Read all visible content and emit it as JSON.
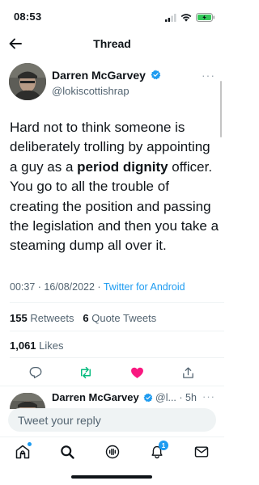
{
  "status_bar": {
    "time": "08:53"
  },
  "header": {
    "title": "Thread",
    "back_icon": "arrow-left-icon"
  },
  "tweet": {
    "author_name": "Darren McGarvey",
    "handle": "@lokiscottishrap",
    "more": "···",
    "text_part1": "Hard not to think someone is deliberately trolling by appointing a guy as a ",
    "text_bold": "period dignity",
    "text_part2": " officer. You go to all the trouble of creating the position and passing the legislation and then you take a steaming dump all over it.",
    "timestamp": "00:37 · 16/08/2022 · ",
    "source": "Twitter for Android",
    "retweets_count": "155",
    "retweets_label": "Retweets",
    "quote_count": "6",
    "quote_label": "Quote Tweets",
    "likes_count": "1,061",
    "likes_label": "Likes",
    "liked": true,
    "accent_color": "#1d9bf0",
    "like_color": "#f91880",
    "retweet_color": "#00ba7c"
  },
  "reply_preview": {
    "author_name": "Darren McGarvey",
    "handle": "@l... · 5h",
    "more": "···"
  },
  "compose": {
    "placeholder": "Tweet your reply"
  },
  "tabbar": {
    "items": [
      {
        "icon": "home-icon",
        "has_dot": true
      },
      {
        "icon": "search-icon"
      },
      {
        "icon": "spaces-icon"
      },
      {
        "icon": "bell-icon",
        "badge": "1"
      },
      {
        "icon": "mail-icon"
      }
    ]
  }
}
